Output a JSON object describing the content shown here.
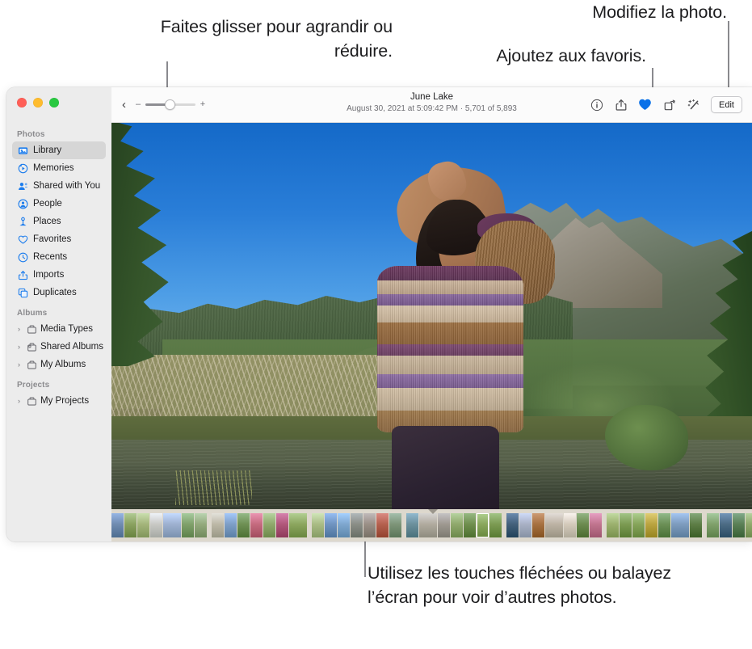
{
  "callouts": {
    "zoom": "Faites glisser pour agrandir ou réduire.",
    "favorite": "Ajoutez aux favoris.",
    "edit": "Modifiez la photo.",
    "arrows": "Utilisez les touches fléchées ou balayez l’écran pour voir d’autres photos."
  },
  "window": {
    "traffic_lights": [
      "close",
      "minimize",
      "zoom"
    ],
    "accent_color": "#0a71e8",
    "icon_blue": "#1b7ced"
  },
  "sidebar": {
    "sections": [
      {
        "title": "Photos",
        "items": [
          {
            "label": "Library",
            "icon": "library-icon",
            "selected": true,
            "disclosure": false
          },
          {
            "label": "Memories",
            "icon": "memories-icon",
            "selected": false,
            "disclosure": false
          },
          {
            "label": "Shared with You",
            "icon": "shared-icon",
            "selected": false,
            "disclosure": false
          },
          {
            "label": "People",
            "icon": "people-icon",
            "selected": false,
            "disclosure": false
          },
          {
            "label": "Places",
            "icon": "places-icon",
            "selected": false,
            "disclosure": false
          },
          {
            "label": "Favorites",
            "icon": "heart-icon",
            "selected": false,
            "disclosure": false
          },
          {
            "label": "Recents",
            "icon": "clock-icon",
            "selected": false,
            "disclosure": false
          },
          {
            "label": "Imports",
            "icon": "import-icon",
            "selected": false,
            "disclosure": false
          },
          {
            "label": "Duplicates",
            "icon": "duplicates-icon",
            "selected": false,
            "disclosure": false
          }
        ]
      },
      {
        "title": "Albums",
        "items": [
          {
            "label": "Media Types",
            "icon": "album-icon",
            "selected": false,
            "disclosure": true
          },
          {
            "label": "Shared Albums",
            "icon": "shared-album-icon",
            "selected": false,
            "disclosure": true
          },
          {
            "label": "My Albums",
            "icon": "album-icon",
            "selected": false,
            "disclosure": true
          }
        ]
      },
      {
        "title": "Projects",
        "items": [
          {
            "label": "My Projects",
            "icon": "album-icon",
            "selected": false,
            "disclosure": true
          }
        ]
      }
    ]
  },
  "toolbar": {
    "back_glyph": "‹",
    "zoom_minus": "–",
    "zoom_plus": "+",
    "zoom_value": 38,
    "title": "June Lake",
    "subtitle": "August 30, 2021 at 5:09:42 PM  ·  5,701 of 5,893",
    "buttons": [
      {
        "name": "info-icon",
        "label": "Info"
      },
      {
        "name": "share-icon",
        "label": "Share"
      },
      {
        "name": "heart-icon",
        "label": "Favorite",
        "active": true
      },
      {
        "name": "rotate-icon",
        "label": "Rotate"
      },
      {
        "name": "auto-enhance-icon",
        "label": "Auto Enhance"
      }
    ],
    "edit_label": "Edit"
  },
  "photo": {
    "title": "June Lake",
    "alt": "Person in striped sweater shielding eyes, mountain lake and forested hills"
  },
  "filmstrip": {
    "selected_index": 26,
    "thumbnails": [
      "#6f8bb0",
      "#8aa15f",
      "#a3b47a",
      "#c8c8c4",
      "#9db0cf",
      "#7fa06a",
      "#93a97c",
      "#bcb7a6",
      "#7d9ec6",
      "#6e8f53",
      "#c46a7e",
      "#8fa86b",
      "#b0577a",
      "#8ba55e",
      "#a9bb84",
      "#6f93bf",
      "#7ea6cd",
      "#8a8d86",
      "#9a8f86",
      "#b4604e",
      "#7d9478",
      "#6b8f9b",
      "#b0aa9e",
      "#9e9890",
      "#8fa86b",
      "#6f8e4e",
      "#89a65c",
      "#7b9a52",
      "#43607a",
      "#a8b0c4",
      "#a6703f",
      "#bcb2a3",
      "#d3c9ba",
      "#6c8a4f",
      "#c0748e",
      "#9bb06d",
      "#7b9a52",
      "#86a45a",
      "#b9a33f",
      "#6b8f56",
      "#7d9bbd",
      "#5d7d46",
      "#7fa06a",
      "#4c6b84",
      "#5a7f55",
      "#8fa86b",
      "#9ab07a",
      "#5f7f4a",
      "#2e3a4a",
      "#cf8f7a",
      "#c9b7a4",
      "#b9b2a8",
      "#d8d4ce",
      "#a0887a",
      "#8e8579",
      "#7b8a92",
      "#6c7b86",
      "#c2b9ab"
    ]
  }
}
